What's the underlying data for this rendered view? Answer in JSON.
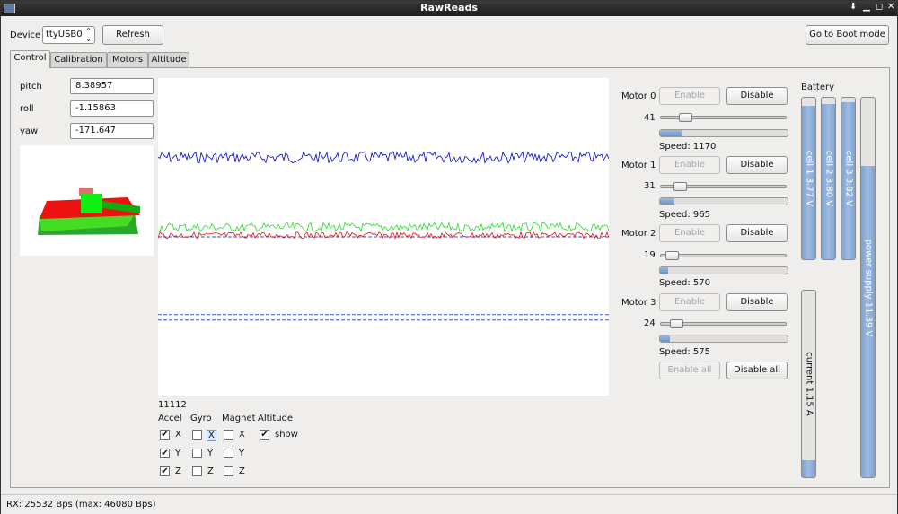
{
  "window": {
    "title": "RawReads"
  },
  "toolbar": {
    "device_label": "Device",
    "device_value": "ttyUSB0",
    "refresh_label": "Refresh",
    "boot_label": "Go to Boot mode"
  },
  "tabs": [
    "Control",
    "Calibration",
    "Motors",
    "Altitude"
  ],
  "orientation": [
    {
      "label": "pitch",
      "value": "8.38957"
    },
    {
      "label": "roll",
      "value": "-1.15863"
    },
    {
      "label": "yaw",
      "value": "-171.647"
    }
  ],
  "chart_data": {
    "type": "line",
    "title": "",
    "sample_count_label": "11112",
    "series": [
      {
        "color": "#0000cc",
        "y_level": 0.25,
        "noise": 0.018
      },
      {
        "color": "#22dd22",
        "y_level": 0.47,
        "noise": 0.014
      },
      {
        "color": "#dd1111",
        "y_level": 0.495,
        "noise": 0.01
      }
    ],
    "reference_lines": [
      {
        "color": "#3355cc",
        "style": "dashed",
        "y_level": 0.5
      },
      {
        "color": "#3355cc",
        "style": "dashed",
        "y_level": 0.745
      },
      {
        "color": "#3355cc",
        "style": "dashed",
        "y_level": 0.762
      }
    ]
  },
  "sensors": {
    "headers": [
      "Accel",
      "Gyro",
      "Magnet",
      "Altitude"
    ],
    "altitude_show": "show",
    "rows": [
      {
        "axis": "X",
        "accel": true,
        "gyro": false,
        "magnet": false
      },
      {
        "axis": "Y",
        "accel": true,
        "gyro": false,
        "magnet": false
      },
      {
        "axis": "Z",
        "accel": true,
        "gyro": false,
        "magnet": false
      }
    ],
    "altitude_checked": true
  },
  "motors": [
    {
      "label": "Motor 0",
      "value": "41",
      "speed": "Speed: 1170",
      "enable": "Enable",
      "disable": "Disable",
      "level": 0.17
    },
    {
      "label": "Motor 1",
      "value": "31",
      "speed": "Speed: 965",
      "enable": "Enable",
      "disable": "Disable",
      "level": 0.11
    },
    {
      "label": "Motor 2",
      "value": "19",
      "speed": "Speed: 570",
      "enable": "Enable",
      "disable": "Disable",
      "level": 0.06
    },
    {
      "label": "Motor 3",
      "value": "24",
      "speed": "Speed: 575",
      "enable": "Enable",
      "disable": "Disable",
      "level": 0.08
    }
  ],
  "motors_all": {
    "enable_all": "Enable all",
    "disable_all": "Disable all"
  },
  "battery": {
    "title": "Battery",
    "cells": [
      {
        "label": "cell 1   3.77 V",
        "level": 0.95
      },
      {
        "label": "cell 2   3.80 V",
        "level": 0.96
      },
      {
        "label": "cell 3   3.82 V",
        "level": 0.97
      }
    ],
    "current": {
      "label": "current   1.15 A",
      "level": 0.09
    },
    "power": {
      "label": "power supply   11.39 V",
      "level": 0.82
    }
  },
  "status": {
    "text": "RX: 25532 Bps (max: 46080 Bps)"
  }
}
